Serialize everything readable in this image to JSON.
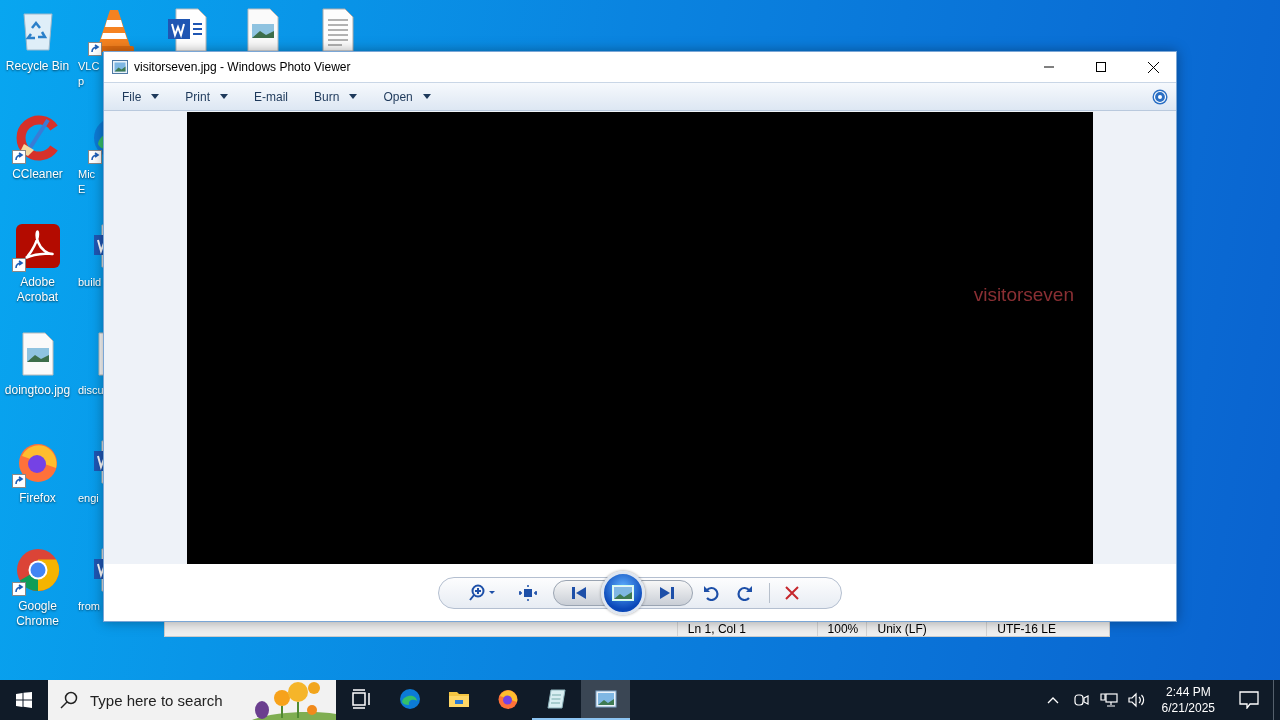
{
  "desktop": {
    "columns": [
      [
        {
          "kind": "recycle-bin",
          "shortcut": false,
          "label_lines": [
            "Recycle Bin"
          ]
        },
        {
          "kind": "ccleaner",
          "shortcut": true,
          "label_lines": [
            "CCleaner"
          ]
        },
        {
          "kind": "acrobat",
          "shortcut": true,
          "label_lines": [
            "Adobe",
            "Acrobat"
          ]
        },
        {
          "kind": "image-file",
          "shortcut": false,
          "label_lines": [
            "doingtoo.jpg"
          ]
        },
        {
          "kind": "firefox",
          "shortcut": true,
          "label_lines": [
            "Firefox"
          ]
        },
        {
          "kind": "chrome",
          "shortcut": true,
          "label_lines": [
            "Google",
            "Chrome"
          ]
        }
      ],
      [
        {
          "kind": "vlc",
          "shortcut": true,
          "label_lines": [
            "VLC",
            "p"
          ]
        },
        {
          "kind": "edge",
          "shortcut": true,
          "label_lines": [
            "Mic",
            "E"
          ]
        },
        {
          "kind": "word-file",
          "shortcut": false,
          "label_lines": [
            "build"
          ]
        },
        {
          "kind": "image-file",
          "shortcut": false,
          "label_lines": [
            "discu"
          ]
        },
        {
          "kind": "word-file",
          "shortcut": false,
          "label_lines": [
            "engi"
          ]
        },
        {
          "kind": "word-file",
          "shortcut": false,
          "label_lines": [
            "from"
          ]
        }
      ],
      [
        {
          "kind": "word-file",
          "shortcut": false
        }
      ],
      [
        {
          "kind": "image-file",
          "shortcut": false
        }
      ],
      [
        {
          "kind": "text-file",
          "shortcut": false
        }
      ]
    ]
  },
  "notepad": {
    "status_bar": [
      "Ln 1, Col 1",
      "100%",
      "Unix (LF)",
      "UTF-16 LE"
    ]
  },
  "photo_viewer": {
    "title": "visitorseven.jpg - Windows Photo Viewer",
    "menus": [
      {
        "label": "File",
        "dropdown": true
      },
      {
        "label": "Print",
        "dropdown": true
      },
      {
        "label": "E-mail",
        "dropdown": false
      },
      {
        "label": "Burn",
        "dropdown": true
      },
      {
        "label": "Open",
        "dropdown": true
      }
    ],
    "image_text": "visitorseven"
  },
  "taskbar": {
    "search": {
      "placeholder": "Type here to search"
    },
    "apps": [
      {
        "kind": "task-view",
        "running": false,
        "selected": false
      },
      {
        "kind": "edge",
        "running": false,
        "selected": false
      },
      {
        "kind": "explorer",
        "running": false,
        "selected": false
      },
      {
        "kind": "firefox",
        "running": false,
        "selected": false
      },
      {
        "kind": "notepad",
        "running": true,
        "selected": false
      },
      {
        "kind": "photo-viewer",
        "running": true,
        "selected": true
      }
    ],
    "time": "2:44 PM",
    "date": "6/21/2025"
  }
}
